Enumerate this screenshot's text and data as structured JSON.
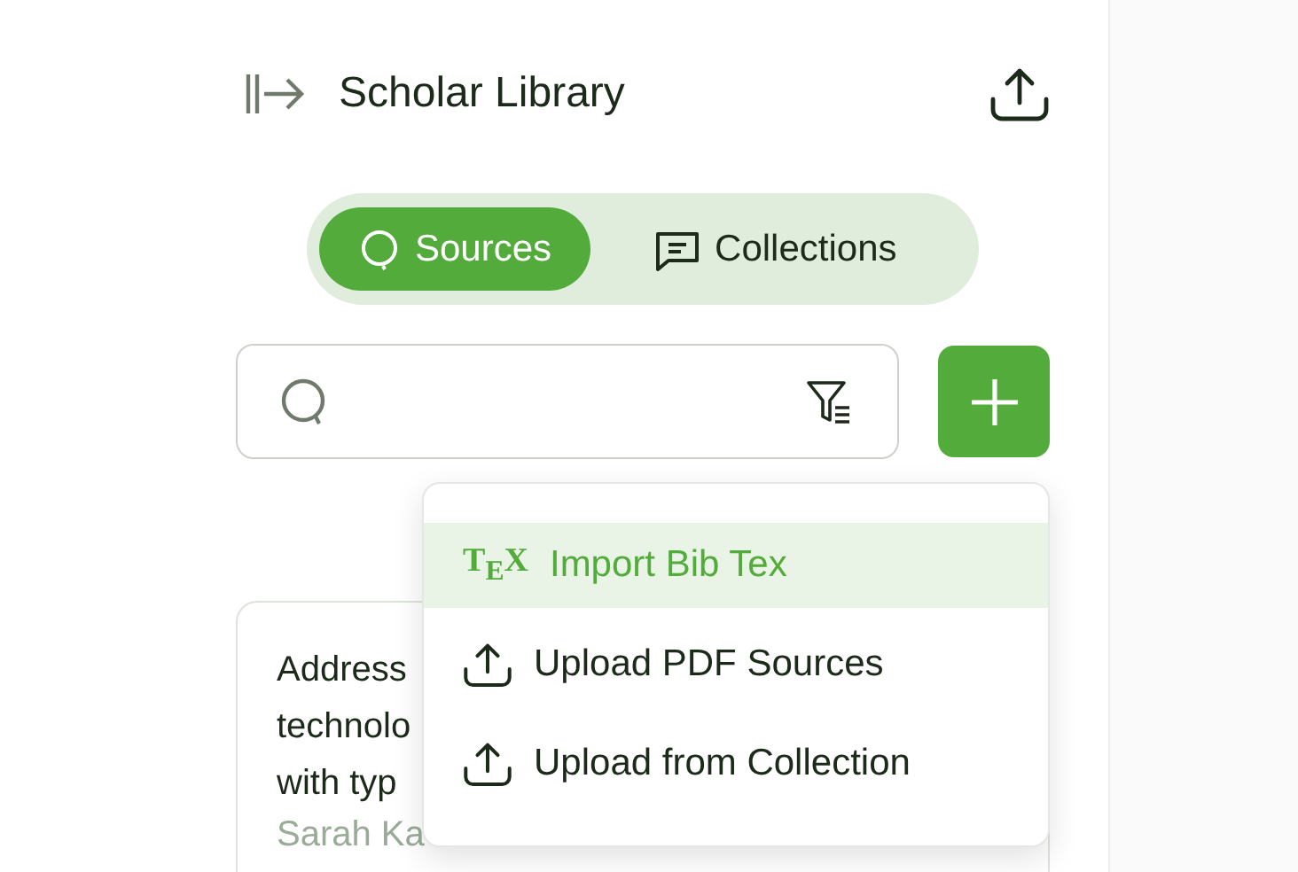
{
  "header": {
    "title": "Scholar Library"
  },
  "tabs": [
    {
      "label": "Sources",
      "selected": true
    },
    {
      "label": "Collections",
      "selected": false
    }
  ],
  "menu": [
    {
      "label": "Import Bib Tex",
      "logo": "T$_{E}$X",
      "selected": true
    },
    {
      "label": "Upload PDF Sources",
      "selected": false
    },
    {
      "label": "Upload from Collection",
      "selected": false
    }
  ],
  "card": {
    "title_lines": [
      "Address",
      "technolo",
      "with typ"
    ],
    "authors": "Sarah Ka"
  }
}
